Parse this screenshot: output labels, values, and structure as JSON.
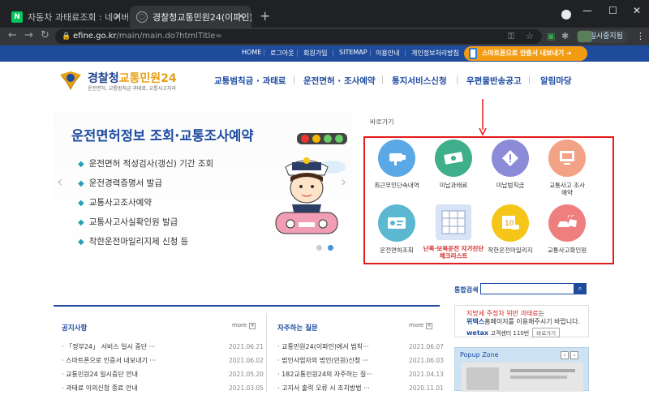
{
  "browser": {
    "tabs": [
      {
        "title": "자동차 과태료조회 : 네이버 통합"
      },
      {
        "title": "경찰청교통민원24(이파인)"
      }
    ],
    "url_host": "efine.go.kr",
    "url_path": "/main/main.do?htmlTitle=",
    "profile_button": "일시중지됨"
  },
  "site": {
    "util_links": [
      "HOME",
      "로그아웃",
      "회원가입",
      "SITEMAP",
      "이용안내",
      "개인정보처리방침"
    ],
    "smart_button": "스마트폰으로 안증서 내보내기",
    "logo": {
      "name_a": "경찰청",
      "name_b": "교통민원24",
      "sub": "운전면허, 교통범칙금 과태료, 교통사고처리"
    },
    "gnb": [
      "교통범칙금 · 과태료",
      "운전면허 · 조사예약",
      "통지서비스신청",
      "우편물반송공고",
      "알림마당"
    ],
    "banner": {
      "title": "운전면허정보 조회·교통조사예약",
      "items": [
        "운전면허 적성검사(갱신) 기간 조회",
        "운전경력증명서 발급",
        "교통사고조사예약",
        "교통사고사실확인원 발급",
        "착한운전마일리지제 신청 등"
      ]
    },
    "quick": {
      "label": "바로가기",
      "items": [
        {
          "label": "최근무인단속내역",
          "color": "#5aa9e6"
        },
        {
          "label": "미납과태료",
          "color": "#3fae8a"
        },
        {
          "label": "미납범칙금",
          "color": "#8b8bd8"
        },
        {
          "label": "교통사고 조사예약",
          "color": "#f2a285"
        },
        {
          "label": "운전면허조회",
          "color": "#5bb8d0"
        },
        {
          "label": "난폭·보복운전 자가진단 체크리스트",
          "color": "#d8e3f5"
        },
        {
          "label": "착한운전마일리지",
          "color": "#f5c518"
        },
        {
          "label": "교통사고확인원",
          "color": "#ef7f7f"
        }
      ]
    },
    "search": {
      "label": "통합검색",
      "placeholder": ""
    },
    "notice": {
      "title": "공지사항",
      "more": "more",
      "rows": [
        {
          "text": "「정부24」 서비스 일시 중단 ···",
          "date": "2021.06.21"
        },
        {
          "text": "스마트폰으로 인증서 내보내기 ···",
          "date": "2021.06.02"
        },
        {
          "text": "교통민원24 일시중단 안내",
          "date": "2021.05.20"
        },
        {
          "text": "과태료 이의신청 종료 안내",
          "date": "2021.03.05"
        }
      ]
    },
    "faq": {
      "title": "자주하는 질문",
      "more": "more",
      "rows": [
        {
          "text": "교통민원24(이파인)에서 범칙···",
          "date": "2021.06.07"
        },
        {
          "text": "법인사업자의 법인(민원)신청 ···",
          "date": "2021.06.03"
        },
        {
          "text": "182교통민원24의 자주하는 질···",
          "date": "2021.04.13"
        },
        {
          "text": "고지서 출력 오류 시 조치방법 ···",
          "date": "2020.11.01"
        }
      ]
    },
    "side_ad": {
      "line1_red": "지방세 주정차 위반 과태료",
      "line1_rest": "는",
      "line2_blue": "위택스",
      "line2_rest": "홈페이지를 이용해주시기 바랍니다.",
      "wetax": "wetax",
      "center": "고객센터 110번",
      "visit": "바로가기"
    },
    "popup_zone": {
      "title": "Popup Zone"
    }
  }
}
